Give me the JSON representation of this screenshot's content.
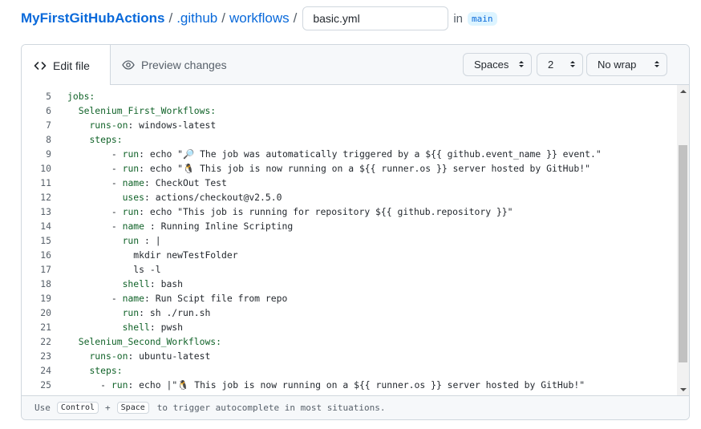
{
  "breadcrumb": {
    "repo": "MyFirstGitHubActions",
    "sep": "/",
    "dir1": ".github",
    "dir2": "workflows",
    "filename": "basic.yml",
    "in_label": "in",
    "branch": "main"
  },
  "tabs": {
    "edit": "Edit file",
    "preview": "Preview changes"
  },
  "options": {
    "indent_mode": "Spaces",
    "indent_size": "2",
    "wrap_mode": "No wrap"
  },
  "code_lines": [
    {
      "n": "5",
      "key": "jobs:",
      "ind": "",
      "pre": "",
      "rest": ""
    },
    {
      "n": "6",
      "key": "Selenium_First_Workflows:",
      "ind": "  ",
      "pre": "",
      "rest": ""
    },
    {
      "n": "7",
      "key": "runs-on",
      "ind": "    ",
      "pre": "",
      "rest": ": windows-latest"
    },
    {
      "n": "8",
      "key": "steps:",
      "ind": "    ",
      "pre": "",
      "rest": ""
    },
    {
      "n": "9",
      "key": "run",
      "ind": "        ",
      "pre": "- ",
      "rest": ": echo \"🔎 The job was automatically triggered by a ${{ github.event_name }} event.\""
    },
    {
      "n": "10",
      "key": "run",
      "ind": "        ",
      "pre": "- ",
      "rest": ": echo \"🐧 This job is now running on a ${{ runner.os }} server hosted by GitHub!\""
    },
    {
      "n": "11",
      "key": "name",
      "ind": "        ",
      "pre": "- ",
      "rest": ": CheckOut Test"
    },
    {
      "n": "12",
      "key": "uses",
      "ind": "          ",
      "pre": "",
      "rest": ": actions/checkout@v2.5.0"
    },
    {
      "n": "13",
      "key": "run",
      "ind": "        ",
      "pre": "- ",
      "rest": ": echo \"This job is running for repository ${{ github.repository }}\""
    },
    {
      "n": "14",
      "key": "name",
      "ind": "        ",
      "pre": "- ",
      "rest": " : Running Inline Scripting"
    },
    {
      "n": "15",
      "key": "run",
      "ind": "          ",
      "pre": "",
      "rest": " : |"
    },
    {
      "n": "16",
      "key": "",
      "ind": "            ",
      "pre": "",
      "rest": "mkdir newTestFolder"
    },
    {
      "n": "17",
      "key": "",
      "ind": "            ",
      "pre": "",
      "rest": "ls -l"
    },
    {
      "n": "18",
      "key": "shell",
      "ind": "          ",
      "pre": "",
      "rest": ": bash"
    },
    {
      "n": "19",
      "key": "name",
      "ind": "        ",
      "pre": "- ",
      "rest": ": Run Scipt file from repo"
    },
    {
      "n": "20",
      "key": "run",
      "ind": "          ",
      "pre": "",
      "rest": ": sh ./run.sh"
    },
    {
      "n": "21",
      "key": "shell",
      "ind": "          ",
      "pre": "",
      "rest": ": pwsh"
    },
    {
      "n": "22",
      "key": "Selenium_Second_Workflows:",
      "ind": "  ",
      "pre": "",
      "rest": ""
    },
    {
      "n": "23",
      "key": "runs-on",
      "ind": "    ",
      "pre": "",
      "rest": ": ubuntu-latest"
    },
    {
      "n": "24",
      "key": "steps:",
      "ind": "    ",
      "pre": "",
      "rest": ""
    },
    {
      "n": "25",
      "key": "run",
      "ind": "      ",
      "pre": "- ",
      "rest": ": echo |\"🐧 This job is now running on a ${{ runner.os }} server hosted by GitHub!\""
    }
  ],
  "footer": {
    "use": "Use",
    "key1": "Control",
    "plus": "+",
    "key2": "Space",
    "rest": "to trigger autocomplete in most situations."
  },
  "colors": {
    "link": "#0969da",
    "yaml_key": "#116329",
    "badge_bg": "#ddf4ff"
  },
  "icons": [
    "code-icon",
    "eye-icon",
    "select-caret-icon",
    "scroll-arrow-icon"
  ]
}
